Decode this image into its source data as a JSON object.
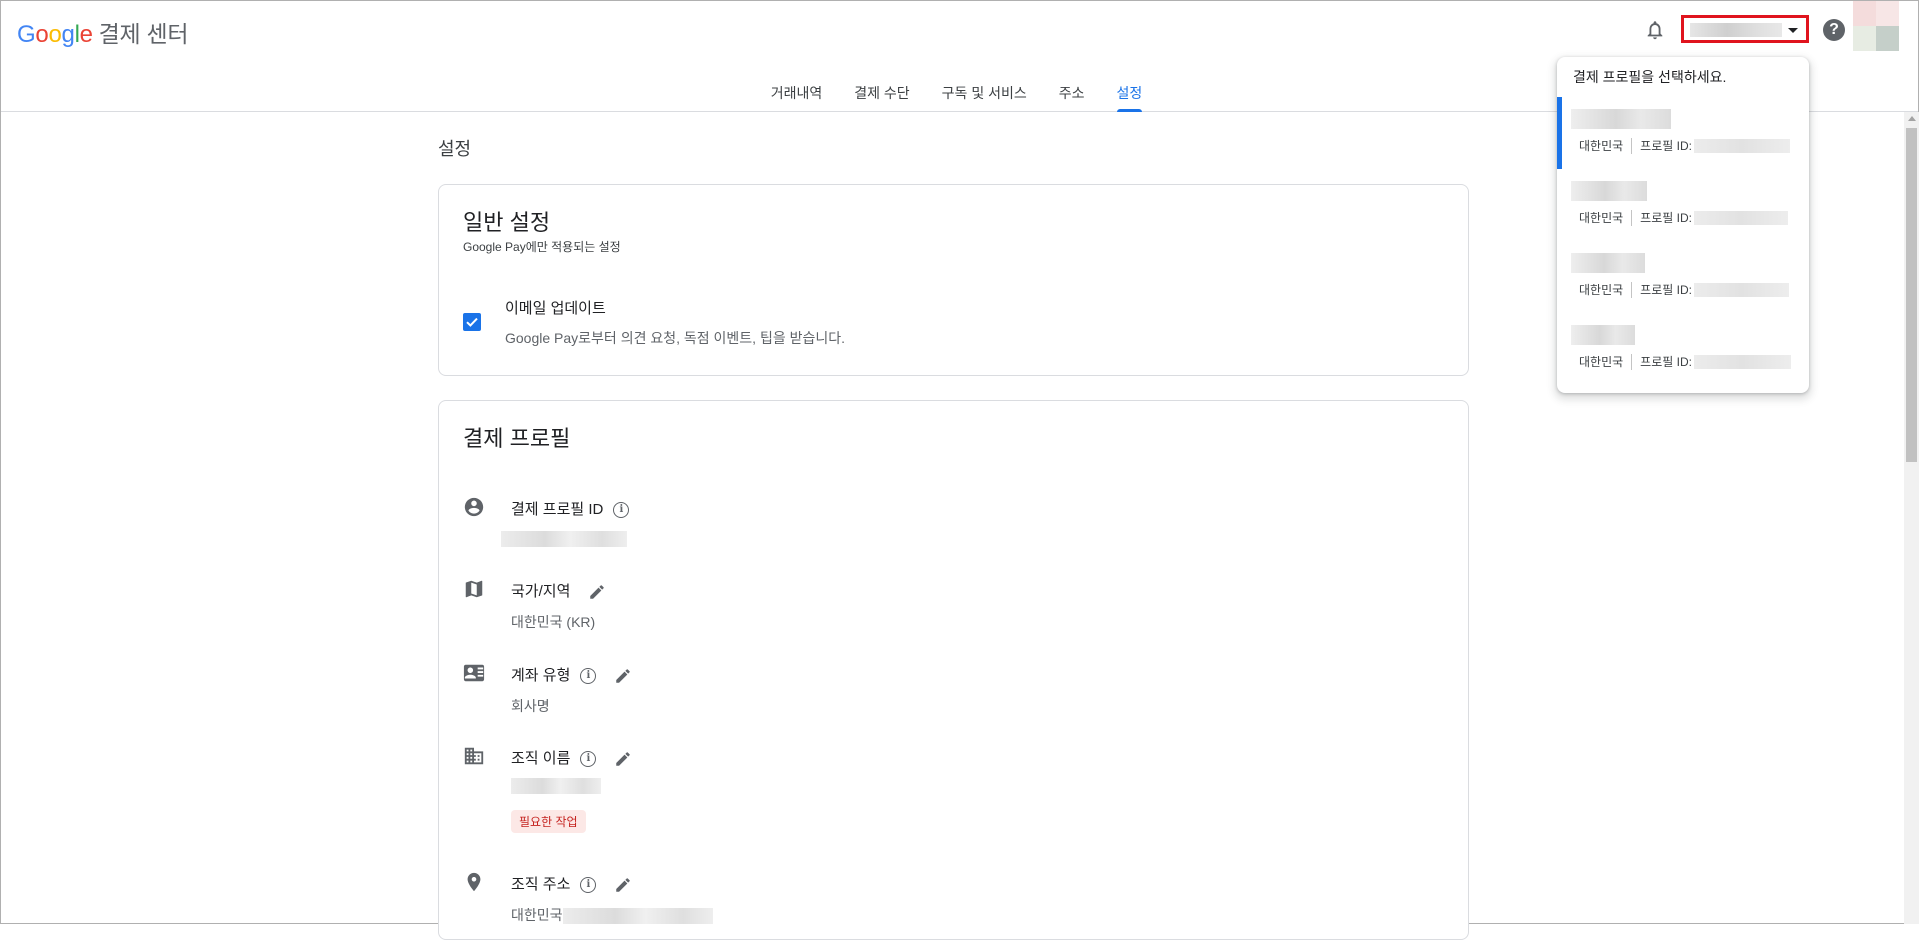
{
  "header": {
    "logo": {
      "G": "G",
      "o1": "o",
      "o2": "o",
      "g": "g",
      "l": "l",
      "e": "e"
    },
    "product_name": "결제 센터",
    "tabs": [
      {
        "label": "거래내역",
        "active": false
      },
      {
        "label": "결제 수단",
        "active": false
      },
      {
        "label": "구독 및 서비스",
        "active": false
      },
      {
        "label": "주소",
        "active": false
      },
      {
        "label": "설정",
        "active": true
      }
    ],
    "help_label": "?",
    "accent_color": "#1a73e8"
  },
  "page": {
    "title": "설정"
  },
  "general_settings": {
    "title": "일반 설정",
    "subtitle": "Google Pay에만 적용되는 설정",
    "email_updates": {
      "checked": true,
      "title": "이메일 업데이트",
      "description": "Google Pay로부터 의견 요청, 독점 이벤트, 팁을 받습니다."
    }
  },
  "payment_profile": {
    "title": "결제 프로필",
    "rows": {
      "profile_id": {
        "label": "결제 프로필 ID",
        "icon": "account-circle-icon"
      },
      "country": {
        "label": "국가/지역",
        "value": "대한민국 (KR)",
        "icon": "map-icon"
      },
      "account_type": {
        "label": "계좌 유형",
        "value": "회사명",
        "icon": "contact-card-icon"
      },
      "org_name": {
        "label": "조직 이름",
        "badge": "필요한 작업",
        "icon": "building-icon"
      },
      "org_address": {
        "label": "조직 주소",
        "value_prefix": "대한민국",
        "icon": "location-pin-icon"
      }
    }
  },
  "profile_dropdown": {
    "heading": "결제 프로필을 선택하세요.",
    "items": [
      {
        "country": "대한민국",
        "id_label": "프로필 ID:",
        "selected": true
      },
      {
        "country": "대한민국",
        "id_label": "프로필 ID:",
        "selected": false
      },
      {
        "country": "대한민국",
        "id_label": "프로필 ID:",
        "selected": false
      },
      {
        "country": "대한민국",
        "id_label": "프로필 ID:",
        "selected": false
      }
    ]
  }
}
